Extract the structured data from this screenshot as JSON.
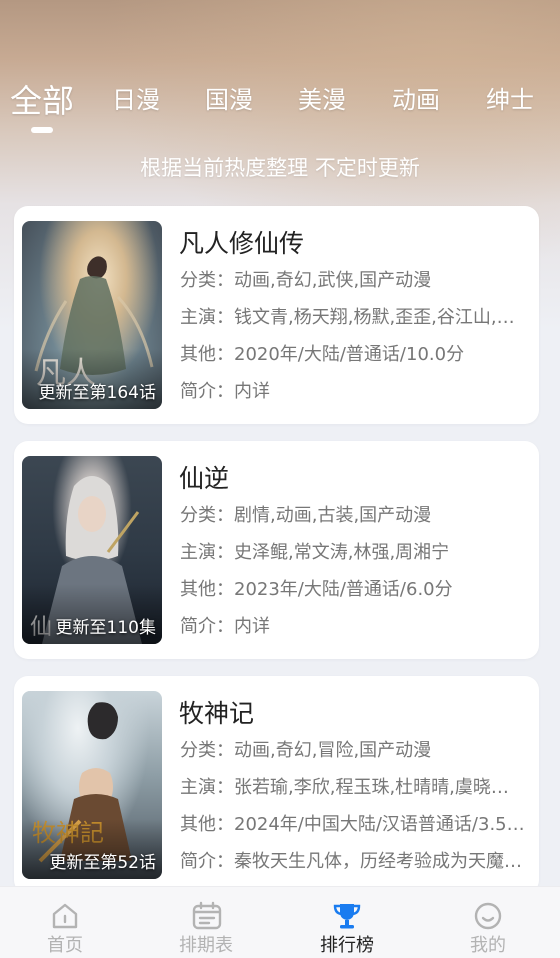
{
  "tabs": [
    {
      "label": "全部",
      "active": true
    },
    {
      "label": "日漫"
    },
    {
      "label": "国漫"
    },
    {
      "label": "美漫"
    },
    {
      "label": "动画"
    },
    {
      "label": "绅士"
    }
  ],
  "subtitle": "根据当前热度整理 不定时更新",
  "cards": [
    {
      "title": "凡人修仙传",
      "badge": "更新至第164话",
      "category": "分类：动画,奇幻,武侠,国产动漫",
      "cast": "主演：钱文青,杨天翔,杨默,歪歪,谷江山,…",
      "other": "其他：2020年/大陆/普通话/10.0分",
      "intro": "简介：内详"
    },
    {
      "title": "仙逆",
      "badge": "更新至110集",
      "category": "分类：剧情,动画,古装,国产动漫",
      "cast": "主演：史泽鲲,常文涛,林强,周湘宁",
      "other": "其他：2023年/大陆/普通话/6.0分",
      "intro": "简介：内详"
    },
    {
      "title": "牧神记",
      "badge": "更新至第52话",
      "category": "分类：动画,奇幻,冒险,国产动漫",
      "cast": "主演：张若瑜,李欣,程玉珠,杜晴晴,虞晓…",
      "other": "其他：2024年/中国大陆/汉语普通话/3.5…",
      "intro": "简介：秦牧天生凡体，历经考验成为天魔…"
    }
  ],
  "bottom_nav": [
    {
      "label": "首页",
      "icon": "home-icon"
    },
    {
      "label": "排期表",
      "icon": "calendar-icon"
    },
    {
      "label": "排行榜",
      "icon": "trophy-icon",
      "active": true
    },
    {
      "label": "我的",
      "icon": "smiley-icon"
    }
  ],
  "colors": {
    "accent": "#1a7cf0",
    "nav_inactive": "#b3b3b3",
    "text_primary": "#222222",
    "text_secondary": "#777777"
  }
}
